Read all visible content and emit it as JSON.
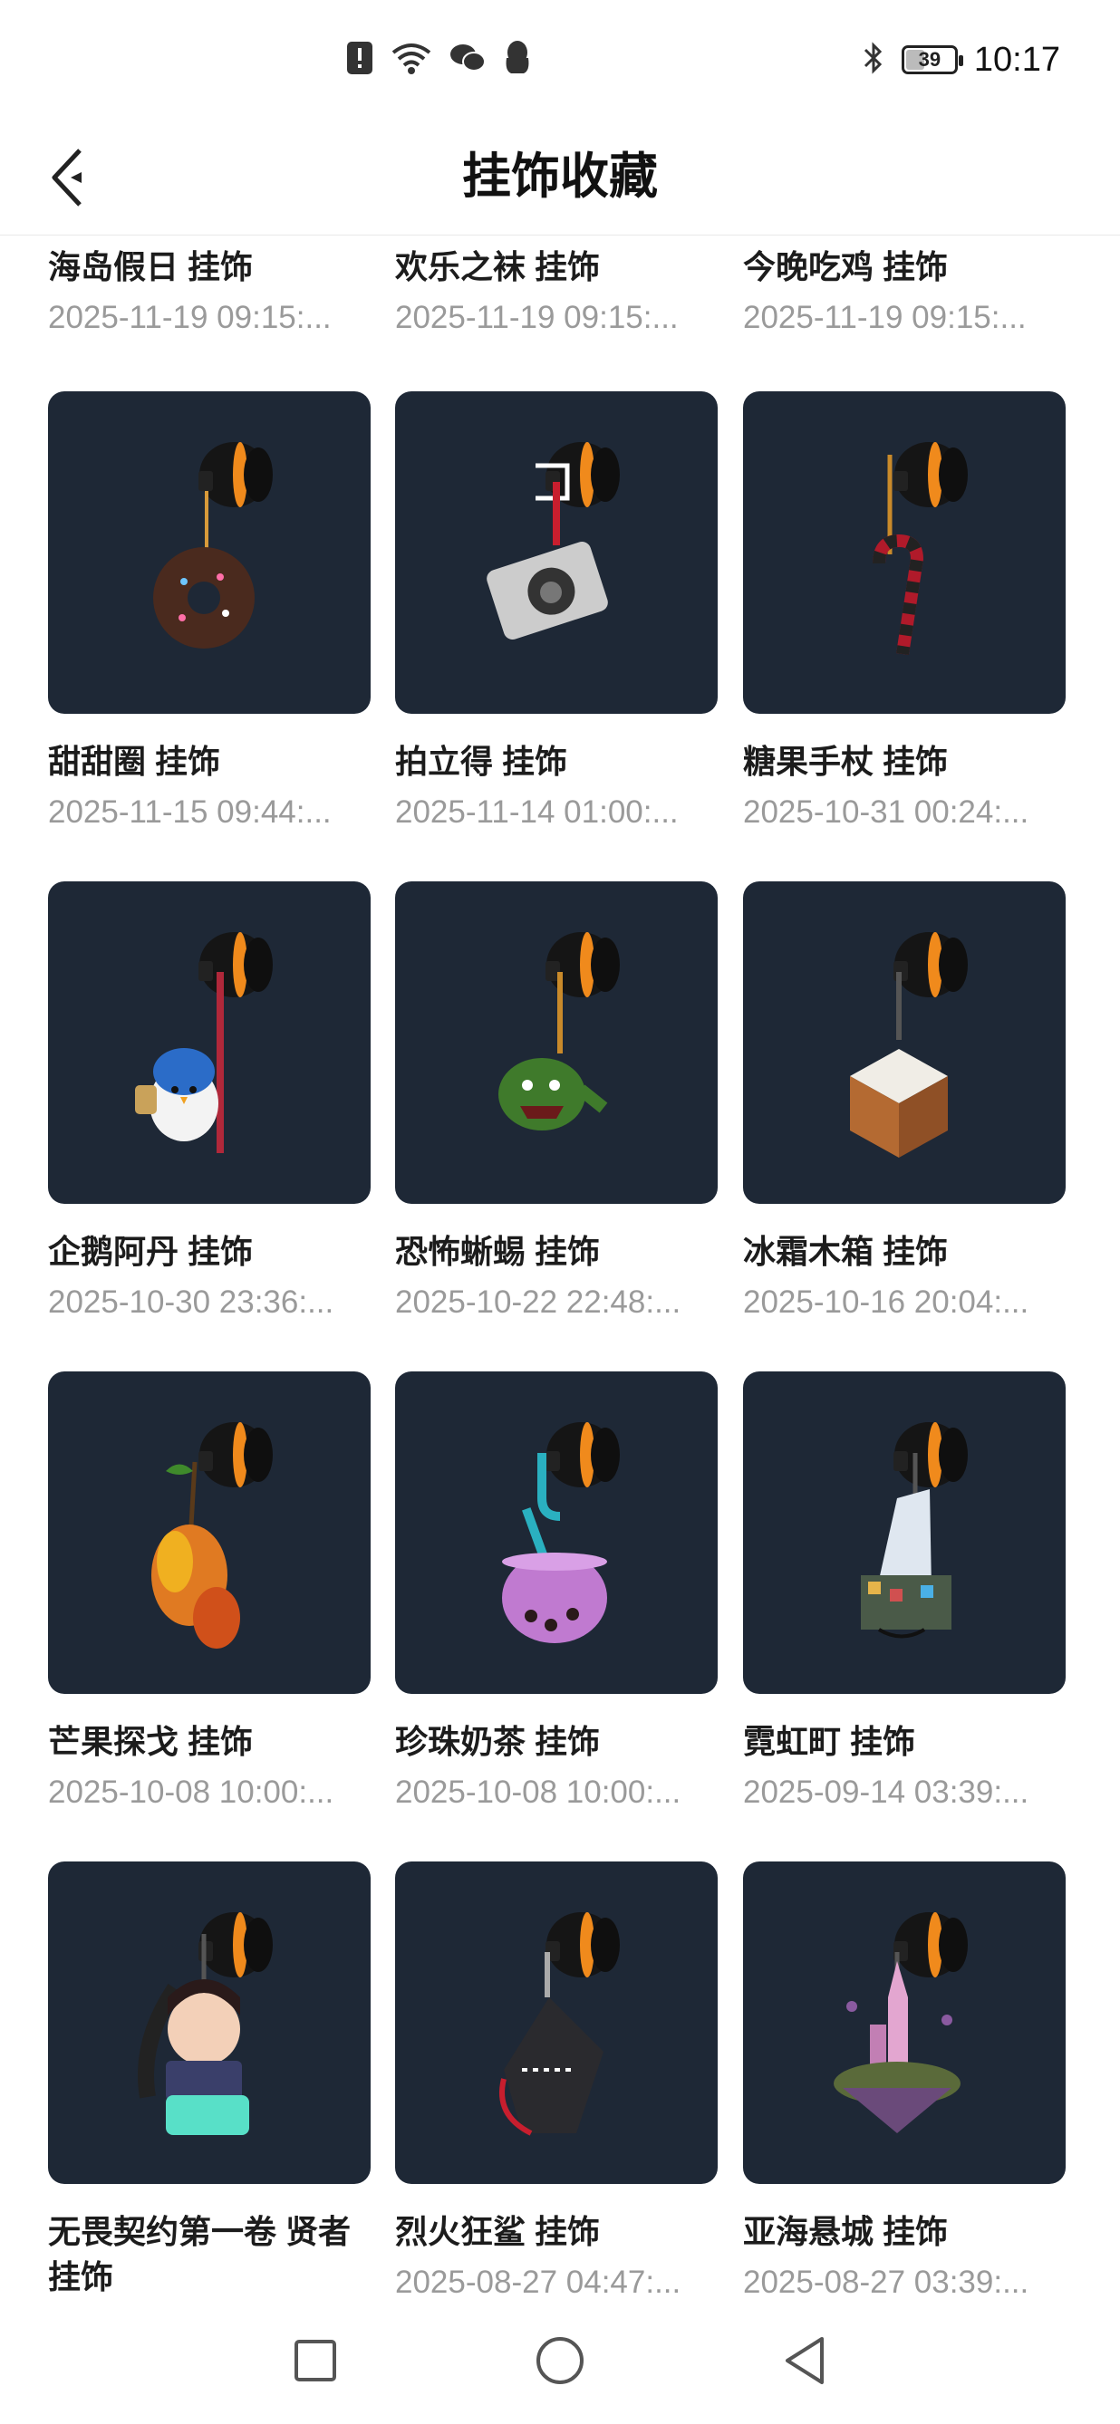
{
  "status_bar": {
    "time": "10:17",
    "battery": "39",
    "icons": [
      "alert-icon",
      "wifi-icon",
      "wechat-icon",
      "qq-icon",
      "bluetooth-icon"
    ]
  },
  "header": {
    "title": "挂饰收藏",
    "back_icon": "back-arrow-icon"
  },
  "colors": {
    "card_bg": "#1e2836",
    "title_text": "#1c1c1c",
    "date_text": "#9a9a9a"
  },
  "items": [
    {
      "name": "海岛假日 挂饰",
      "date": "2025-11-19 09:15:..."
    },
    {
      "name": "欢乐之袜 挂饰",
      "date": "2025-11-19 09:15:..."
    },
    {
      "name": "今晚吃鸡 挂饰",
      "date": "2025-11-19 09:15:..."
    },
    {
      "name": "甜甜圈 挂饰",
      "date": "2025-11-15 09:44:...",
      "icon": "donut-charm-icon"
    },
    {
      "name": "拍立得 挂饰",
      "date": "2025-11-14 01:00:...",
      "icon": "camera-charm-icon"
    },
    {
      "name": "糖果手杖 挂饰",
      "date": "2025-10-31 00:24:...",
      "icon": "candy-cane-charm-icon"
    },
    {
      "name": "企鹅阿丹 挂饰",
      "date": "2025-10-30 23:36:...",
      "icon": "penguin-charm-icon"
    },
    {
      "name": "恐怖蜥蜴 挂饰",
      "date": "2025-10-22 22:48:...",
      "icon": "lizard-charm-icon"
    },
    {
      "name": "冰霜木箱 挂饰",
      "date": "2025-10-16 20:04:...",
      "icon": "crate-charm-icon"
    },
    {
      "name": "芒果探戈 挂饰",
      "date": "2025-10-08 10:00:...",
      "icon": "mango-charm-icon"
    },
    {
      "name": "珍珠奶茶 挂饰",
      "date": "2025-10-08 10:00:...",
      "icon": "bubble-tea-charm-icon"
    },
    {
      "name": "霓虹町 挂饰",
      "date": "2025-09-14 03:39:...",
      "icon": "neon-city-charm-icon"
    },
    {
      "name": "无畏契约第一卷 贤者 挂饰",
      "date": "",
      "icon": "sage-charm-icon"
    },
    {
      "name": "烈火狂鲨 挂饰",
      "date": "2025-08-27 04:47:...",
      "icon": "shark-charm-icon"
    },
    {
      "name": "亚海悬城 挂饰",
      "date": "2025-08-27 03:39:...",
      "icon": "floating-city-charm-icon"
    }
  ],
  "nav": {
    "recent_icon": "square-recent-icon",
    "home_icon": "circle-home-icon",
    "back_icon": "triangle-back-icon"
  }
}
